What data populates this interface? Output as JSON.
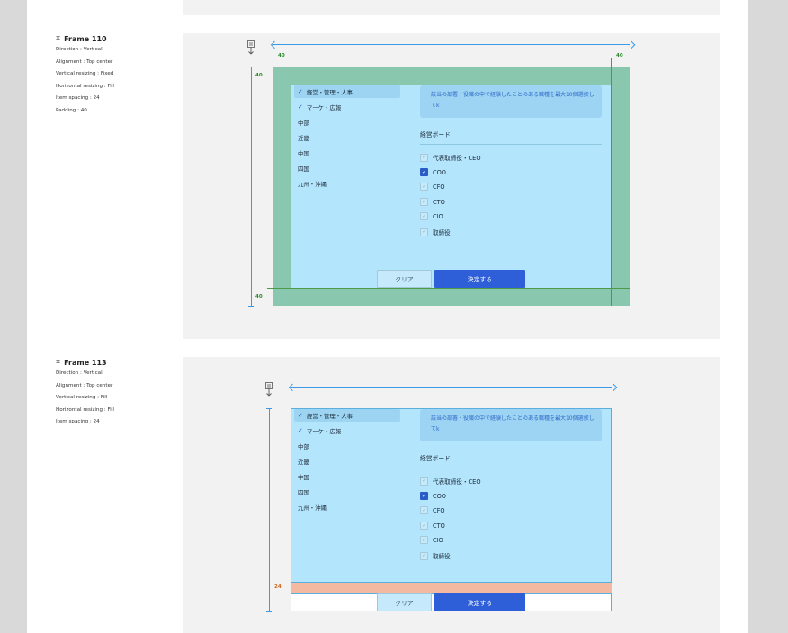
{
  "frames": [
    {
      "title": "Frame 110",
      "props": [
        "Direction : Vertical",
        "Alignment : Top center",
        "Vertical resizing : Fixed",
        "Horizontal resizing : Fill",
        "Item spacing : 24",
        "Padding : 40"
      ],
      "padding_labels": {
        "left": "40",
        "right": "40",
        "top": "40",
        "bottom": "40"
      }
    },
    {
      "title": "Frame 113",
      "props": [
        "Direction : Vertical",
        "Alignment : Top center",
        "Vertical resizing : Fill",
        "Horizontal resizing : Fill",
        "Item spacing : 24"
      ],
      "spacing_label": "24"
    }
  ],
  "region_list": [
    {
      "label": "経営・管理・人事",
      "selected": true
    },
    {
      "label": "マーケ・広報",
      "selected": true
    },
    {
      "label": "中部",
      "selected": false
    },
    {
      "label": "近畿",
      "selected": false
    },
    {
      "label": "中国",
      "selected": false
    },
    {
      "label": "四国",
      "selected": false
    },
    {
      "label": "九州・沖縄",
      "selected": false
    }
  ],
  "info_text": "該当の部署・役職の中で経験したことのある職種を最大10個選択してk",
  "section_title": "経営ボード",
  "options": [
    {
      "label": "代表取締役・CEO",
      "checked": false
    },
    {
      "label": "COO",
      "checked": true
    },
    {
      "label": "CFO",
      "checked": false
    },
    {
      "label": "CTO",
      "checked": false
    },
    {
      "label": "CIO",
      "checked": false
    },
    {
      "label": "取締役",
      "checked": false
    }
  ],
  "buttons": {
    "clear": "クリア",
    "submit": "決定する"
  },
  "icons": {
    "frame": "frame-hash-icon",
    "resize": "vertical-resize-icon",
    "check": "checkmark-icon"
  },
  "colors": {
    "panel": "#b3e5fc",
    "primary": "#2f5fd8",
    "padding": "#5ca85c",
    "spacing": "#f2aa8c",
    "measure": "#3b9ae8"
  }
}
